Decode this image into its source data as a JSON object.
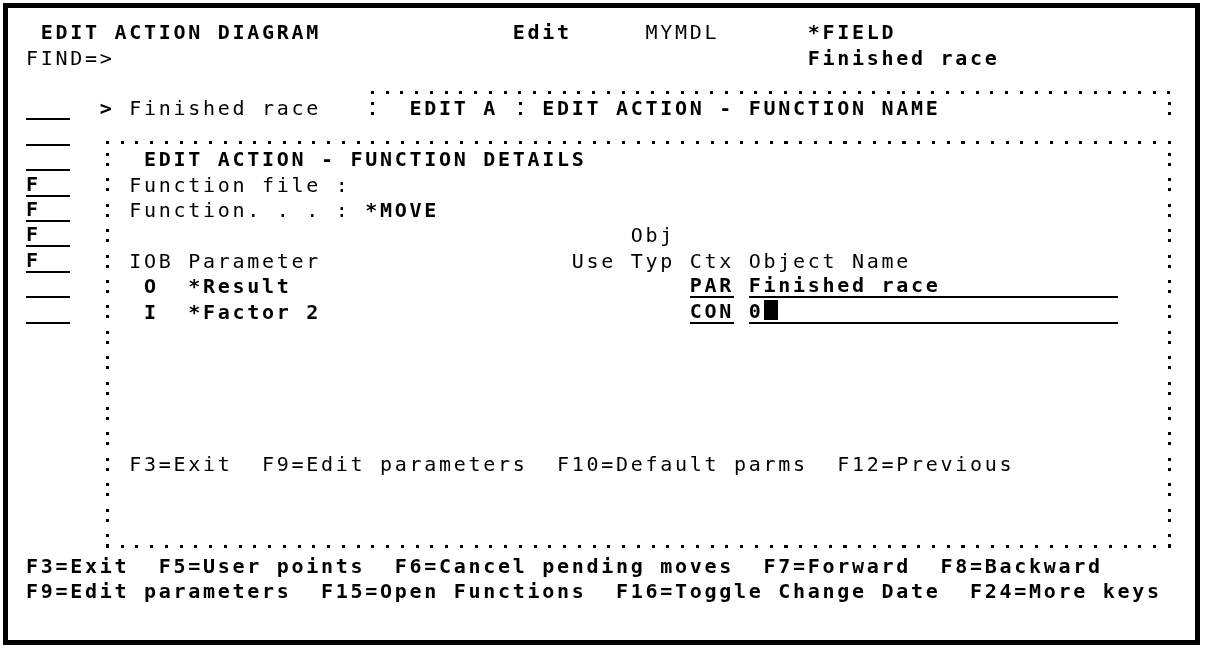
{
  "header": {
    "title": "EDIT ACTION DIAGRAM",
    "mode": "Edit",
    "model": "MYMDL",
    "object_type": "*FIELD",
    "find_label": "FIND=>",
    "object_name": "Finished race"
  },
  "line_commands": [
    {
      "kind": "blank"
    },
    {
      "kind": "blank"
    },
    {
      "kind": "blank"
    },
    {
      "kind": "entered",
      "value": "F"
    },
    {
      "kind": "entered",
      "value": "F"
    },
    {
      "kind": "entered",
      "value": "F"
    },
    {
      "kind": "entered",
      "value": "F"
    },
    {
      "kind": "blank"
    },
    {
      "kind": "blank"
    }
  ],
  "action_line": {
    "marker": ">",
    "text": "Finished race"
  },
  "name_window": {
    "label": "EDIT A",
    "title": "EDIT ACTION - FUNCTION NAME"
  },
  "details_window": {
    "title": "EDIT ACTION - FUNCTION DETAILS",
    "fields": [
      {
        "label": "Function file :"
      },
      {
        "label": "Function. . . :",
        "value": "*MOVE"
      }
    ],
    "columns": [
      {
        "label": "IOB"
      },
      {
        "label": "Parameter"
      },
      {
        "label": "Use"
      },
      {
        "label_above": "Obj",
        "label": "Typ"
      },
      {
        "label": "Ctx"
      },
      {
        "label": "Object Name"
      }
    ],
    "parameters": [
      {
        "iob": "O",
        "name": "*Result",
        "ctx": "PAR",
        "object_name": "Finished race",
        "cursor": false
      },
      {
        "iob": "I",
        "name": "*Factor 2",
        "ctx": "CON",
        "object_name": "0",
        "cursor": true
      }
    ],
    "function_keys": [
      "F3=Exit",
      "F9=Edit parameters",
      "F10=Default parms",
      "F12=Previous"
    ]
  },
  "function_key_rows": [
    {
      "keys": [
        "F3=Exit",
        "F5=User points",
        "F6=Cancel pending moves",
        "F7=Forward",
        "F8=Backward"
      ]
    },
    {
      "keys": [
        "F9=Edit parameters",
        "F15=Open Functions",
        "F16=Toggle Change Date",
        "F24=More keys"
      ]
    }
  ]
}
